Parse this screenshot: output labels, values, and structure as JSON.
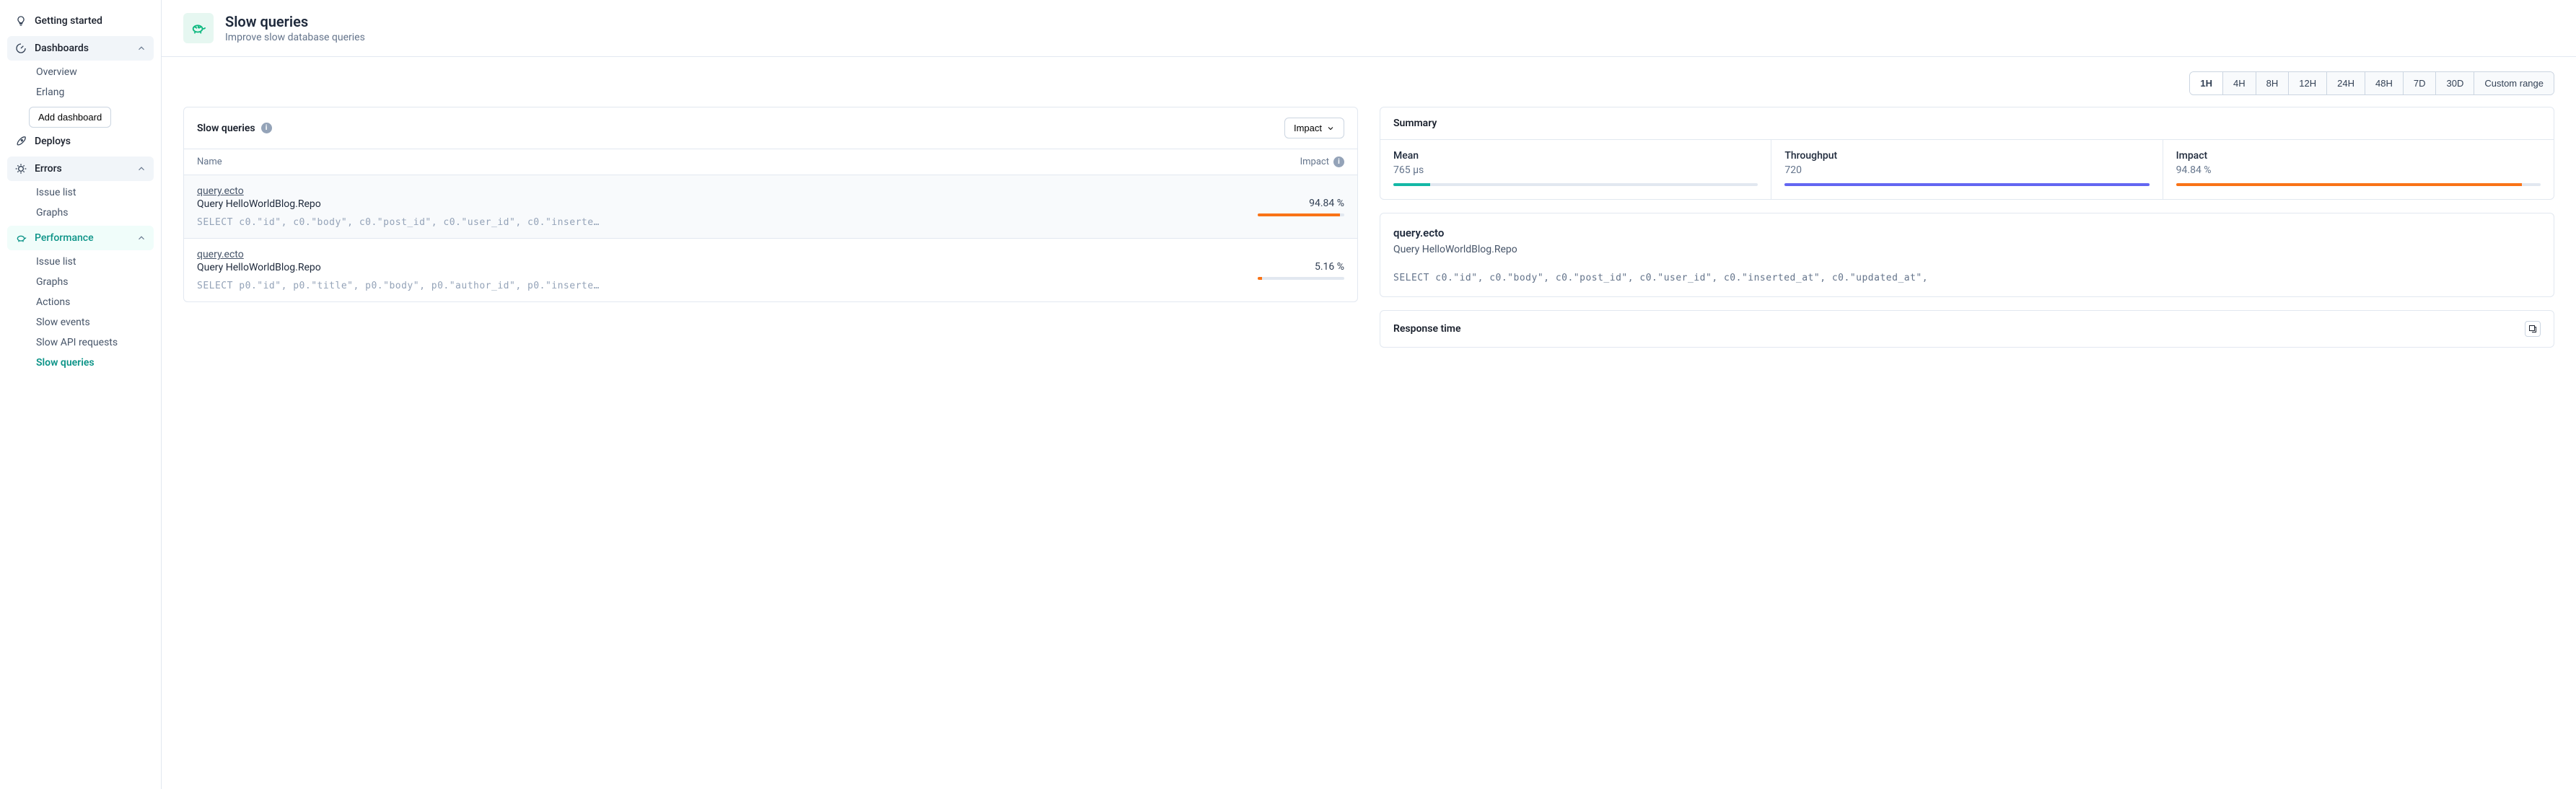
{
  "sidebar": {
    "getting_started": "Getting started",
    "dashboards": {
      "label": "Dashboards",
      "items": [
        "Overview",
        "Erlang"
      ],
      "add_label": "Add dashboard"
    },
    "deploys": "Deploys",
    "errors": {
      "label": "Errors",
      "items": [
        "Issue list",
        "Graphs"
      ]
    },
    "performance": {
      "label": "Performance",
      "items": [
        "Issue list",
        "Graphs",
        "Actions",
        "Slow events",
        "Slow API requests",
        "Slow queries"
      ]
    }
  },
  "header": {
    "title": "Slow queries",
    "subtitle": "Improve slow database queries"
  },
  "time_ranges": [
    "1H",
    "4H",
    "8H",
    "12H",
    "24H",
    "48H",
    "7D",
    "30D",
    "Custom range"
  ],
  "queries_panel": {
    "title": "Slow queries",
    "sort_label": "Impact",
    "col_name": "Name",
    "col_impact": "Impact",
    "rows": [
      {
        "name": "query.ecto",
        "repo": "Query HelloWorldBlog.Repo",
        "sql": "SELECT c0.\"id\", c0.\"body\", c0.\"post_id\", c0.\"user_id\", c0.\"inserte…",
        "impact": "94.84 %"
      },
      {
        "name": "query.ecto",
        "repo": "Query HelloWorldBlog.Repo",
        "sql": "SELECT p0.\"id\", p0.\"title\", p0.\"body\", p0.\"author_id\", p0.\"inserte…",
        "impact": "5.16 %"
      }
    ]
  },
  "summary": {
    "title": "Summary",
    "mean": {
      "label": "Mean",
      "value": "765 µs"
    },
    "throughput": {
      "label": "Throughput",
      "value": "720"
    },
    "impact": {
      "label": "Impact",
      "value": "94.84 %"
    }
  },
  "detail": {
    "name": "query.ecto",
    "repo": "Query HelloWorldBlog.Repo",
    "sql": "SELECT c0.\"id\", c0.\"body\", c0.\"post_id\", c0.\"user_id\", c0.\"inserted_at\", c0.\"updated_at\","
  },
  "response_time": {
    "title": "Response time"
  }
}
